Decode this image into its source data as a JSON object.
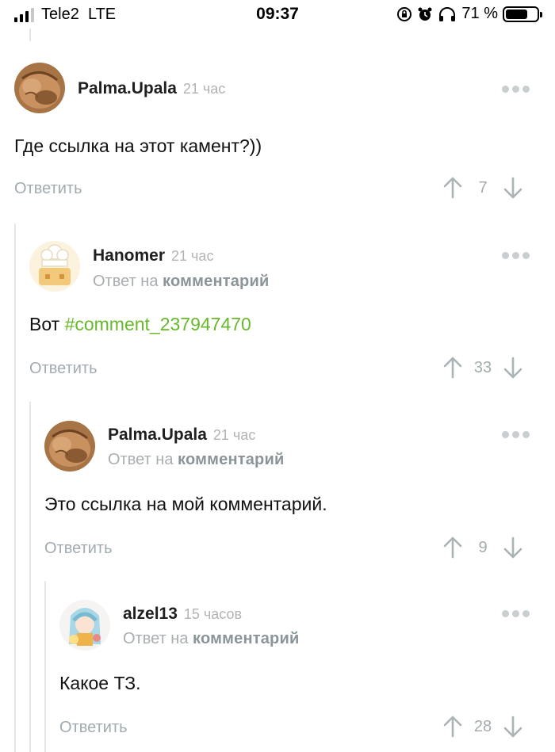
{
  "status_bar": {
    "carrier": "Tele2",
    "network": "LTE",
    "time": "09:37",
    "battery": "71 %",
    "battery_level": 0.71
  },
  "comments": [
    {
      "author": "Palma.Upala",
      "time": "21 час",
      "reply_prefix": "",
      "reply_link": "",
      "text": "Где ссылка на этот камент?))",
      "reply_label": "Ответить",
      "votes": "7"
    },
    {
      "author": "Hanomer",
      "time": "21 час",
      "reply_prefix": "Ответ на",
      "reply_link": "комментарий",
      "text": "Вот ",
      "hashtag": "#comment_237947470",
      "reply_label": "Ответить",
      "votes": "33"
    },
    {
      "author": "Palma.Upala",
      "time": "21 час",
      "reply_prefix": "Ответ на",
      "reply_link": "комментарий",
      "text": "Это ссылка на мой комментарий.",
      "reply_label": "Ответить",
      "votes": "9"
    },
    {
      "author": "alzel13",
      "time": "15 часов",
      "reply_prefix": "Ответ на",
      "reply_link": "комментарий",
      "text": "Какое ТЗ.",
      "reply_label": "Ответить",
      "votes": "28"
    }
  ],
  "colors": {
    "hashtag": "#67b82b",
    "muted": "#a0acb0",
    "thread_line": "#e6e6e6"
  }
}
